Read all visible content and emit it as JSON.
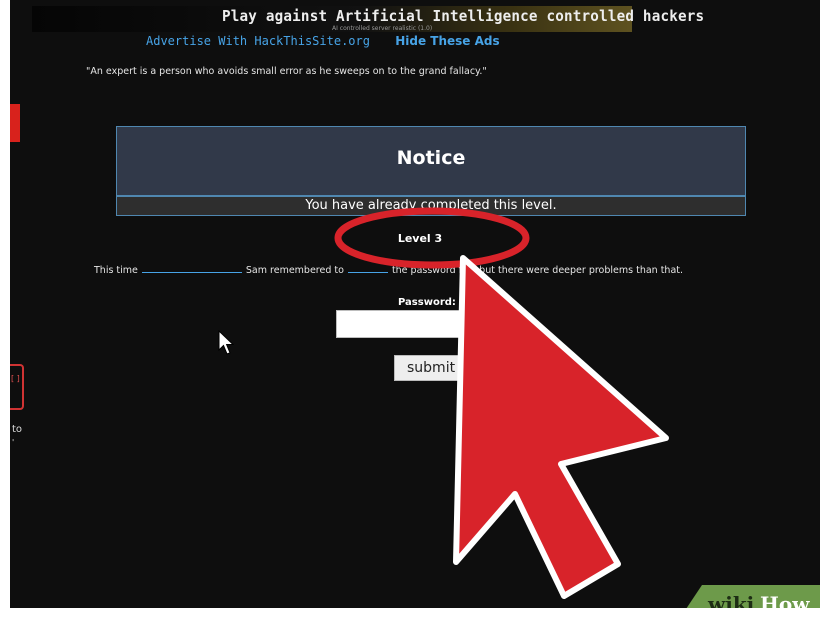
{
  "banner": {
    "text": "Play against Artificial Intelligence controlled hackers",
    "subtext": "AI controlled server  realistic  (1.0)"
  },
  "ads": {
    "advertise_link": "Advertise With HackThisSite.org",
    "hide_link": "Hide These Ads"
  },
  "quote": "\"An expert is a person who avoids small error as he sweeps on to the grand fallacy.\"",
  "notice": {
    "title": "Notice",
    "message": "You have already completed this level."
  },
  "level": {
    "title": "Level 3"
  },
  "hint": {
    "part1": "This time",
    "part2": "Sam remembered to",
    "part3": "the password file, but there were deeper problems than that."
  },
  "form": {
    "password_label": "Password:",
    "password_value": "",
    "submit_label": "submit"
  },
  "sidebar": {
    "box_text": "[ ]",
    "to_text": "to",
    "tick_text": "'"
  },
  "watermark": {
    "wiki": "wiki",
    "how": "How"
  },
  "colors": {
    "accent_red": "#d8232a",
    "link_blue": "#47a3e6",
    "notice_bg": "#313949",
    "page_bg": "#0e0e0e",
    "watermark_green": "#6d9a4a"
  },
  "icons": {
    "mouse_pointer": "cursor-arrow-icon",
    "annotation_arrow": "big-red-arrow-icon"
  }
}
